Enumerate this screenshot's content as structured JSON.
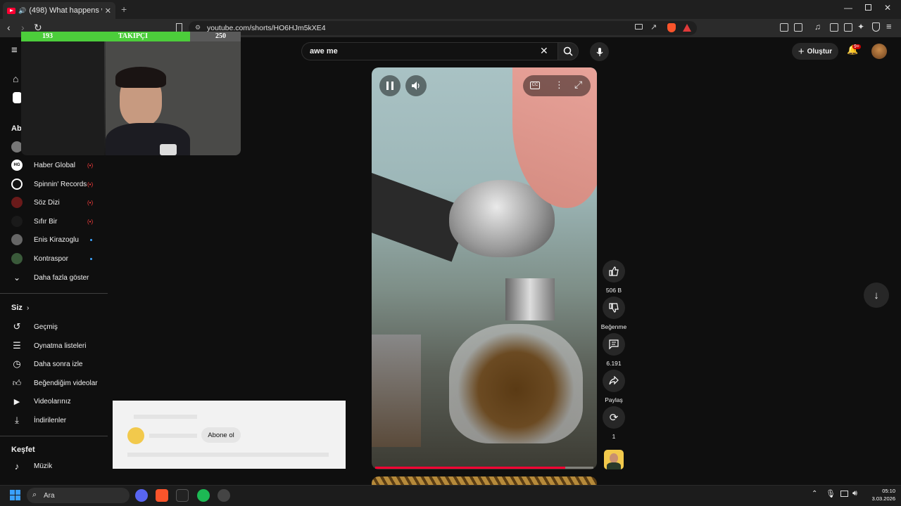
{
  "browser": {
    "tab_title": "(498) What happens when yo",
    "url": "youtube.com/shorts/HO6HJm5kXE4"
  },
  "header": {
    "search_value": "awe me",
    "create_label": "Oluştur",
    "notif_count": "9+"
  },
  "follow_overlay": {
    "left": "193",
    "label": "TAKIPÇI",
    "right": "250",
    "progress": 0.77
  },
  "sidebar": {
    "subs_head": "Abo",
    "channels": [
      {
        "name": "Haber Global",
        "live": "(•)"
      },
      {
        "name": "Spinnin' Records",
        "live": "(•)"
      },
      {
        "name": "Söz Dizi",
        "live": "(•)"
      },
      {
        "name": "Sıfır Bir",
        "live": "(•)"
      },
      {
        "name": "Enis Kirazoglu",
        "live": ""
      },
      {
        "name": "Kontraspor",
        "live": ""
      }
    ],
    "show_more": "Daha fazla göster",
    "you_head": "Siz",
    "you_items": [
      "Geçmiş",
      "Oynatma listeleri",
      "Daha sonra izle",
      "Beğendiğim videolar",
      "Videolarınız",
      "İndirilenler"
    ],
    "explore_head": "Keşfet",
    "explore_items": [
      "Müzik"
    ]
  },
  "actions": {
    "likes": "506 B",
    "dislike_label": "Beğenme",
    "comments": "6.191",
    "share_label": "Paylaş",
    "remix_count": "1"
  },
  "video": {
    "progress": 0.87
  },
  "popup": {
    "subscribe_label": "Abone ol"
  },
  "taskbar": {
    "search_label": "Ara",
    "time": "05:10",
    "date": "3.03.2026"
  }
}
